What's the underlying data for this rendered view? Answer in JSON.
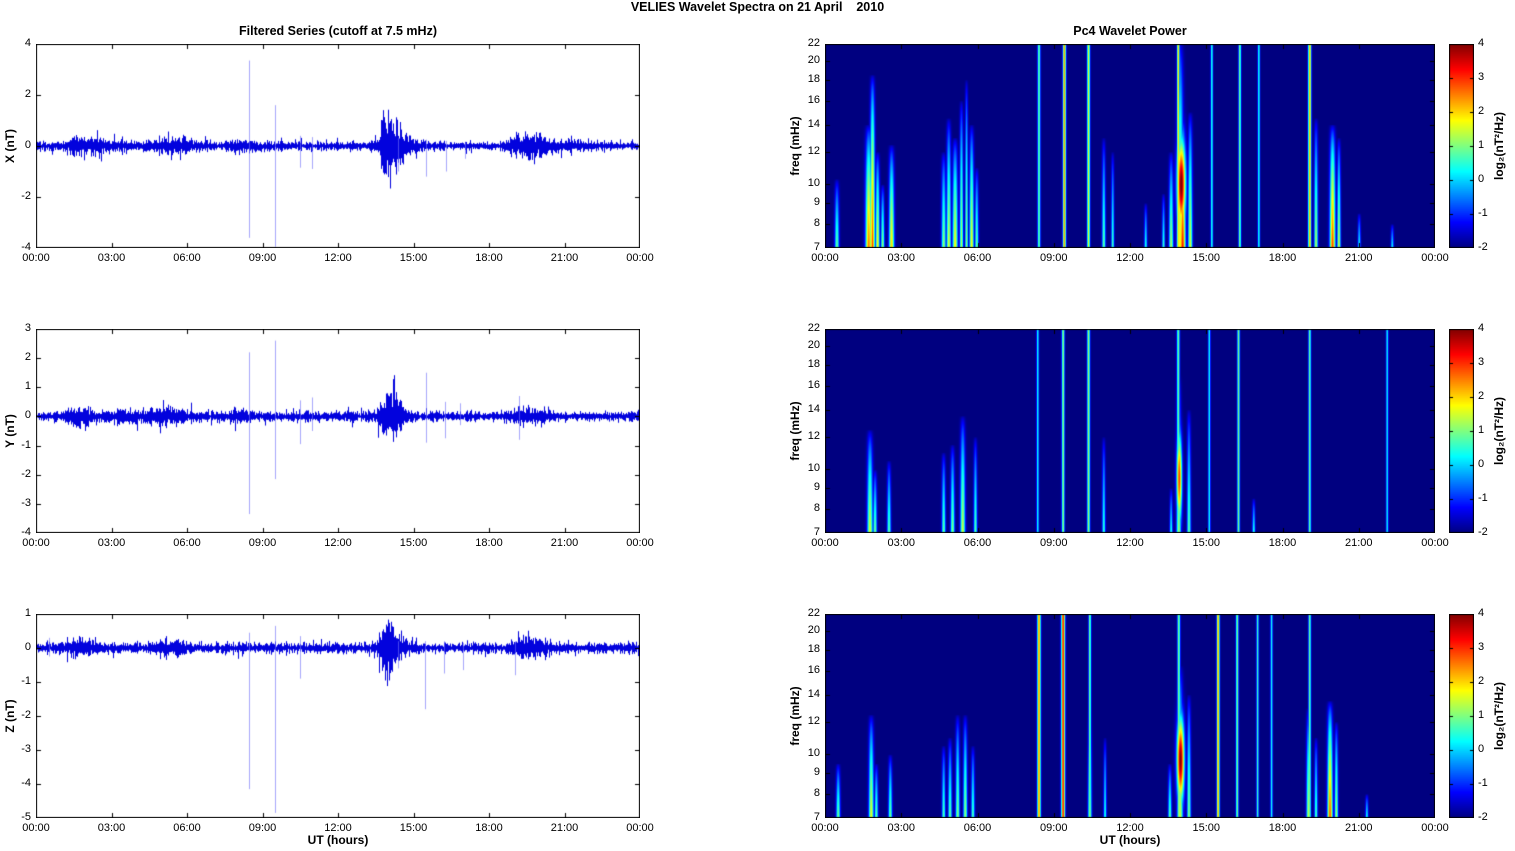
{
  "figure": {
    "title": "VELIES Wavelet Spectra on 21 April    2010",
    "background": "#ffffff",
    "series_color": "#0202dd",
    "spike_color": "#7070fa",
    "colormap": "jet"
  },
  "xaxis": {
    "lim": [
      0,
      24
    ],
    "tick_values": [
      0,
      3,
      6,
      9,
      12,
      15,
      18,
      21,
      24
    ],
    "tick_labels": [
      "00:00",
      "03:00",
      "06:00",
      "09:00",
      "12:00",
      "15:00",
      "18:00",
      "21:00",
      "00:00"
    ]
  },
  "colorbar": {
    "label": "log₂(nT²/Hz)",
    "range": [
      -2,
      4
    ],
    "ticks": [
      -2,
      -1,
      0,
      1,
      2,
      3,
      4
    ]
  },
  "chart_data": [
    {
      "id": "x-filtered-series",
      "type": "line",
      "title": "Filtered Series (cutoff at 7.5 mHz)",
      "ylabel": "X (nT)",
      "xlabel": "",
      "ylim": [
        -4,
        4
      ],
      "yticks": [
        -4,
        -2,
        0,
        2,
        4
      ],
      "noise_amp": 0.12,
      "seed": 7,
      "bursts": [
        {
          "t": 1.75,
          "w": 0.35,
          "a": 0.18
        },
        {
          "t": 2.45,
          "w": 0.25,
          "a": 0.12
        },
        {
          "t": 3.35,
          "w": 0.3,
          "a": 0.07
        },
        {
          "t": 5.3,
          "w": 0.5,
          "a": 0.12
        },
        {
          "t": 5.95,
          "w": 0.2,
          "a": 0.1
        },
        {
          "t": 8.05,
          "w": 0.3,
          "a": 0.07
        },
        {
          "t": 13.95,
          "w": 0.18,
          "a": 0.75
        },
        {
          "t": 14.2,
          "w": 0.35,
          "a": 0.4
        },
        {
          "t": 14.6,
          "w": 0.3,
          "a": 0.18
        },
        {
          "t": 19.25,
          "w": 0.3,
          "a": 0.22
        },
        {
          "t": 19.95,
          "w": 0.35,
          "a": 0.24
        },
        {
          "t": 21.3,
          "w": 0.4,
          "a": 0.08
        }
      ],
      "spikes": [
        {
          "t": 8.45,
          "up": 3.35,
          "down": -3.6
        },
        {
          "t": 9.5,
          "up": 1.6,
          "down": -3.95
        },
        {
          "t": 10.5,
          "up": 0.4,
          "down": -0.85
        },
        {
          "t": 10.95,
          "up": 0.35,
          "down": -0.9
        },
        {
          "t": 14.4,
          "up": 0.3,
          "down": -1.0
        },
        {
          "t": 15.5,
          "up": 0.25,
          "down": -1.2
        },
        {
          "t": 16.3,
          "up": 0.2,
          "down": -1.0
        },
        {
          "t": 17.05,
          "up": 0.15,
          "down": -0.5
        }
      ]
    },
    {
      "id": "y-filtered-series",
      "type": "line",
      "title": "",
      "ylabel": "Y (nT)",
      "xlabel": "",
      "ylim": [
        -4,
        3
      ],
      "yticks": [
        -4,
        -3,
        -2,
        -1,
        0,
        1,
        2,
        3
      ],
      "noise_amp": 0.11,
      "seed": 13,
      "bursts": [
        {
          "t": 1.75,
          "w": 0.4,
          "a": 0.16
        },
        {
          "t": 3.6,
          "w": 0.5,
          "a": 0.07
        },
        {
          "t": 4.6,
          "w": 0.4,
          "a": 0.07
        },
        {
          "t": 5.35,
          "w": 0.5,
          "a": 0.1
        },
        {
          "t": 8.05,
          "w": 0.3,
          "a": 0.06
        },
        {
          "t": 13.95,
          "w": 0.22,
          "a": 0.42
        },
        {
          "t": 14.25,
          "w": 0.3,
          "a": 0.28
        },
        {
          "t": 19.25,
          "w": 0.3,
          "a": 0.12
        },
        {
          "t": 19.95,
          "w": 0.3,
          "a": 0.1
        }
      ],
      "spikes": [
        {
          "t": 8.45,
          "up": 2.2,
          "down": -3.35
        },
        {
          "t": 9.5,
          "up": 2.6,
          "down": -2.15
        },
        {
          "t": 10.5,
          "up": 0.55,
          "down": -0.95
        },
        {
          "t": 10.95,
          "up": 0.65,
          "down": -0.5
        },
        {
          "t": 15.5,
          "up": 1.5,
          "down": -0.9
        },
        {
          "t": 16.25,
          "up": 0.5,
          "down": -0.75
        },
        {
          "t": 16.85,
          "up": 0.45,
          "down": -0.3
        },
        {
          "t": 19.2,
          "up": 0.7,
          "down": -0.8
        }
      ]
    },
    {
      "id": "z-filtered-series",
      "type": "line",
      "title": "",
      "ylabel": "Z (nT)",
      "xlabel": "UT (hours)",
      "ylim": [
        -5,
        1
      ],
      "yticks": [
        -5,
        -4,
        -3,
        -2,
        -1,
        0,
        1
      ],
      "noise_amp": 0.1,
      "seed": 29,
      "bursts": [
        {
          "t": 1.75,
          "w": 0.35,
          "a": 0.14
        },
        {
          "t": 5.35,
          "w": 0.5,
          "a": 0.09
        },
        {
          "t": 13.95,
          "w": 0.2,
          "a": 0.42
        },
        {
          "t": 14.25,
          "w": 0.3,
          "a": 0.22
        },
        {
          "t": 19.25,
          "w": 0.3,
          "a": 0.15
        },
        {
          "t": 19.95,
          "w": 0.3,
          "a": 0.14
        }
      ],
      "spikes": [
        {
          "t": 0.5,
          "up": 0.3,
          "down": -0.25
        },
        {
          "t": 8.45,
          "up": 0.45,
          "down": -4.15
        },
        {
          "t": 9.5,
          "up": 0.65,
          "down": -4.85
        },
        {
          "t": 10.5,
          "up": 0.35,
          "down": -0.9
        },
        {
          "t": 14.4,
          "up": 0.2,
          "down": -0.6
        },
        {
          "t": 15.45,
          "up": 0.2,
          "down": -1.8
        },
        {
          "t": 16.2,
          "up": 0.2,
          "down": -0.75
        },
        {
          "t": 16.95,
          "up": 0.15,
          "down": -0.65
        },
        {
          "t": 19.05,
          "up": 0.2,
          "down": -0.8
        }
      ]
    },
    {
      "id": "x-wavelet-power",
      "type": "heatmap",
      "title": "Pc4 Wavelet Power",
      "ylabel": "freq (mHz)",
      "xlabel": "",
      "ylim": [
        7,
        22
      ],
      "yscale": "log",
      "yticks": [
        7,
        8,
        9,
        10,
        12,
        14,
        16,
        18,
        20,
        22
      ],
      "clim": [
        -2,
        4
      ],
      "plume_format": [
        "t_hours",
        "fmax_mHz",
        "peak_log2_power",
        "sigma_px"
      ],
      "plumes": [
        [
          0.45,
          10.3,
          0.9,
          1.5
        ],
        [
          1.7,
          14,
          2.6,
          2.2
        ],
        [
          1.85,
          18.5,
          2.9,
          1.6
        ],
        [
          2.05,
          12,
          1.8,
          1.4
        ],
        [
          2.25,
          10,
          1.2,
          1.2
        ],
        [
          2.6,
          12.5,
          2.0,
          1.8
        ],
        [
          4.65,
          12,
          1.2,
          1.5
        ],
        [
          4.85,
          14.5,
          1.6,
          1.5
        ],
        [
          5.1,
          13,
          1.8,
          1.8
        ],
        [
          5.35,
          16,
          1.4,
          1.2
        ],
        [
          5.55,
          18,
          1.2,
          1.0
        ],
        [
          5.75,
          14,
          1.8,
          1.5
        ],
        [
          5.95,
          11,
          1.0,
          1.2
        ],
        [
          10.95,
          13,
          0.9,
          1.2
        ],
        [
          11.3,
          12,
          0.7,
          1.0
        ],
        [
          12.6,
          9,
          0.5,
          1.0
        ],
        [
          13.3,
          9.5,
          0.6,
          1.0
        ],
        [
          13.6,
          12,
          1.3,
          1.5
        ],
        [
          13.95,
          22.5,
          1.9,
          2.2
        ],
        [
          14.05,
          14.5,
          3.2,
          2.0
        ],
        [
          14.35,
          15,
          1.6,
          1.5
        ],
        [
          19.3,
          14.5,
          1.3,
          1.3
        ],
        [
          19.95,
          14,
          2.9,
          1.9
        ],
        [
          20.2,
          13,
          1.5,
          1.2
        ],
        [
          21.0,
          8.5,
          0.4,
          1.0
        ],
        [
          22.3,
          8,
          0.3,
          1.0
        ]
      ],
      "line_format": [
        "t_hours",
        "value_log2_power",
        "sigma_px"
      ],
      "lines": [
        [
          8.4,
          0.9,
          1.0
        ],
        [
          9.4,
          2.3,
          1.1
        ],
        [
          10.35,
          1.6,
          1.0
        ],
        [
          13.88,
          2.0,
          0.9
        ],
        [
          15.2,
          0.5,
          0.8
        ],
        [
          16.3,
          1.0,
          0.9
        ],
        [
          17.05,
          0.4,
          0.8
        ],
        [
          19.05,
          2.1,
          1.1
        ]
      ],
      "blob_format": [
        "t_hours",
        "fc_mHz",
        "peak",
        "sigma_px",
        "sigma_lnf"
      ],
      "blobs": [
        [
          14.0,
          10,
          4.1,
          3.0,
          0.18
        ]
      ]
    },
    {
      "id": "y-wavelet-power",
      "type": "heatmap",
      "title": "",
      "ylabel": "freq (mHz)",
      "xlabel": "",
      "ylim": [
        7,
        22
      ],
      "yscale": "log",
      "yticks": [
        7,
        8,
        9,
        10,
        12,
        14,
        16,
        18,
        20,
        22
      ],
      "clim": [
        -2,
        4
      ],
      "plumes": [
        [
          1.75,
          12.5,
          1.6,
          1.9
        ],
        [
          1.95,
          10,
          1.0,
          1.3
        ],
        [
          2.5,
          10.5,
          0.9,
          1.3
        ],
        [
          4.65,
          11,
          0.9,
          1.3
        ],
        [
          5.0,
          11.5,
          1.1,
          1.4
        ],
        [
          5.4,
          13.5,
          1.5,
          1.7
        ],
        [
          5.9,
          12,
          0.8,
          1.2
        ],
        [
          10.95,
          12,
          0.6,
          1.1
        ],
        [
          13.6,
          9,
          0.5,
          1.0
        ],
        [
          13.9,
          17,
          1.2,
          1.6
        ],
        [
          14.3,
          14,
          0.9,
          1.3
        ],
        [
          16.85,
          8.5,
          0.5,
          1.0
        ]
      ],
      "lines": [
        [
          8.35,
          0.35,
          0.8
        ],
        [
          9.35,
          1.1,
          1.0
        ],
        [
          10.35,
          1.15,
          1.0
        ],
        [
          13.88,
          0.9,
          1.0
        ],
        [
          15.1,
          0.35,
          0.8
        ],
        [
          16.25,
          0.95,
          0.9
        ],
        [
          19.05,
          0.85,
          0.9
        ],
        [
          22.1,
          0.25,
          0.8
        ]
      ],
      "blobs": [
        [
          13.92,
          9.5,
          2.9,
          1.9,
          0.18
        ]
      ]
    },
    {
      "id": "z-wavelet-power",
      "type": "heatmap",
      "title": "",
      "ylabel": "freq (mHz)",
      "xlabel": "UT (hours)",
      "ylim": [
        7,
        22
      ],
      "yscale": "log",
      "yticks": [
        7,
        8,
        9,
        10,
        12,
        14,
        16,
        18,
        20,
        22
      ],
      "clim": [
        -2,
        4
      ],
      "plumes": [
        [
          0.5,
          9.5,
          1.0,
          1.4
        ],
        [
          1.8,
          12.5,
          1.7,
          1.7
        ],
        [
          2.0,
          9.5,
          0.9,
          1.2
        ],
        [
          2.55,
          10,
          1.0,
          1.3
        ],
        [
          4.65,
          10.5,
          0.8,
          1.2
        ],
        [
          4.9,
          11,
          0.9,
          1.3
        ],
        [
          5.2,
          12.5,
          1.1,
          1.4
        ],
        [
          5.5,
          12.5,
          1.2,
          1.4
        ],
        [
          5.8,
          10.5,
          0.8,
          1.2
        ],
        [
          10.4,
          13,
          1.1,
          1.3
        ],
        [
          11.0,
          11,
          0.5,
          1.0
        ],
        [
          13.55,
          9.5,
          0.9,
          1.2
        ],
        [
          13.95,
          16.5,
          1.5,
          2.0
        ],
        [
          14.3,
          14,
          1.1,
          1.3
        ],
        [
          19.0,
          13,
          1.4,
          1.4
        ],
        [
          19.3,
          11,
          0.8,
          1.1
        ],
        [
          19.85,
          13.5,
          2.8,
          1.8
        ],
        [
          20.1,
          12,
          1.3,
          1.2
        ],
        [
          21.3,
          8,
          0.4,
          1.0
        ]
      ],
      "lines": [
        [
          8.4,
          2.4,
          1.2
        ],
        [
          9.35,
          3.1,
          1.3
        ],
        [
          10.4,
          1.0,
          0.9
        ],
        [
          13.9,
          1.0,
          1.0
        ],
        [
          15.45,
          2.2,
          1.0
        ],
        [
          16.2,
          1.0,
          0.9
        ],
        [
          17.0,
          0.6,
          0.8
        ],
        [
          17.55,
          0.35,
          0.8
        ],
        [
          19.05,
          0.9,
          0.9
        ]
      ],
      "blobs": [
        [
          13.97,
          9.7,
          4.0,
          2.6,
          0.17
        ]
      ]
    }
  ]
}
